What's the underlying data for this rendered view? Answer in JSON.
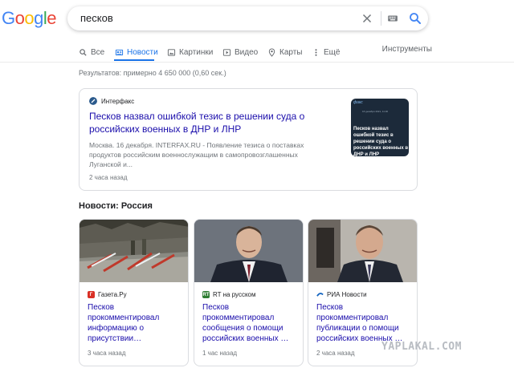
{
  "brand": {
    "letters": [
      "G",
      "o",
      "o",
      "g",
      "l",
      "e"
    ],
    "colors": [
      "#4285f4",
      "#ea4335",
      "#fbbc05",
      "#4285f4",
      "#34a853",
      "#ea4335"
    ]
  },
  "search": {
    "value": "песков"
  },
  "tabs": [
    {
      "label": "Все",
      "icon": "search-icon"
    },
    {
      "label": "Новости",
      "icon": "news-icon",
      "active": true
    },
    {
      "label": "Картинки",
      "icon": "image-icon"
    },
    {
      "label": "Видео",
      "icon": "video-icon"
    },
    {
      "label": "Карты",
      "icon": "map-pin-icon"
    },
    {
      "label": "Ещё",
      "icon": "more-vert-icon"
    }
  ],
  "tools_label": "Инструменты",
  "result_stats": "Результатов: примерно 4 650 000 (0,60 сек.)",
  "top_story": {
    "source": "Интерфакс",
    "title": "Песков назвал ошибкой тезис в решении суда о российских военных в ДНР и ЛНР",
    "snippet": "Москва. 16 декабря. INTERFAX.RU - Появление тезиса о поставках продуктов российским военнослужащим в самопровозглашенных Луганской и...",
    "time": "2 часа назад",
    "thumb_logo": "факс",
    "thumb_date": "16 декабря 2021, 11:30",
    "thumb_text": "Песков назвал ошибкой тезис в решении суда о российских военных в ДНР и ЛНР"
  },
  "section_title": "Новости: Россия",
  "news": [
    {
      "source": "Газета.Ру",
      "favicon_letter": "Г",
      "favicon_color": "#d93025",
      "title": "Песков прокомментировал информацию о присутствии…",
      "time": "3 часа назад"
    },
    {
      "source": "RT на русском",
      "favicon_letter": "RT",
      "favicon_color": "#2e7d32",
      "title": "Песков прокомментировал сообщения о помощи российских военных …",
      "time": "1 час назад"
    },
    {
      "source": "РИА Новости",
      "favicon_letter": "",
      "favicon_color": "#1565c0",
      "title": "Песков прокомментировал публикации о помощи российских военных …",
      "time": "2 часа назад"
    }
  ],
  "watermark": "YAPLAKAL.COM",
  "colors": {
    "link": "#1a0dab",
    "accent": "#1a73e8",
    "muted": "#70757a"
  }
}
